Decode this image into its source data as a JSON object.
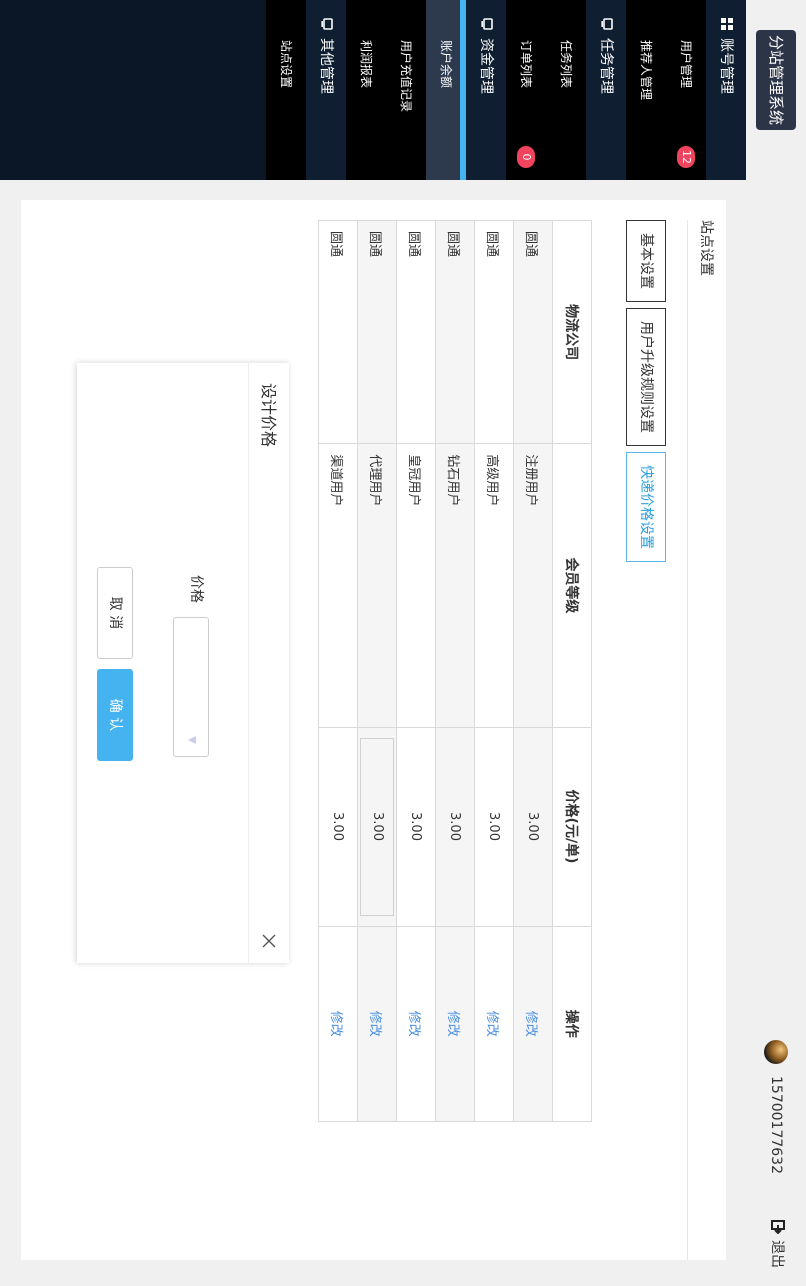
{
  "header": {
    "brand_title": "分站管理系统",
    "user_phone": "15700177632",
    "logout_label": "退出"
  },
  "sidebar": {
    "groups": [
      {
        "label": "账号管理",
        "icon": "grid-icon",
        "items": [
          {
            "label": "用户管理",
            "badge": "12"
          },
          {
            "label": "推荐人管理"
          }
        ]
      },
      {
        "label": "任务管理",
        "icon": "monitor-icon",
        "items": [
          {
            "label": "任务列表"
          },
          {
            "label": "订单列表",
            "badge": "0"
          }
        ]
      },
      {
        "label": "资金管理",
        "icon": "monitor-icon",
        "items": [
          {
            "label": "账户余额",
            "active": true
          },
          {
            "label": "用户充值记录"
          },
          {
            "label": "利润报表"
          }
        ]
      },
      {
        "label": "其他管理",
        "icon": "monitor-icon",
        "items": [
          {
            "label": "站点设置"
          }
        ]
      }
    ]
  },
  "main": {
    "section_title": "站点设置",
    "tabs": [
      {
        "label": "基本设置",
        "active": false
      },
      {
        "label": "用户升级规则设置",
        "active": false
      },
      {
        "label": "快递价格设置",
        "active": true
      }
    ],
    "table": {
      "columns": [
        "物流公司",
        "会员等级",
        "价格(元/单)",
        "操作"
      ],
      "rows": [
        [
          "圆通",
          "注册用户",
          "3.00",
          "修改"
        ],
        [
          "圆通",
          "高级用户",
          "3.00",
          "修改"
        ],
        [
          "圆通",
          "钻石用户",
          "3.00",
          "修改"
        ],
        [
          "圆通",
          "皇冠用户",
          "3.00",
          "修改"
        ],
        [
          "圆通",
          "代理用户",
          "3.00",
          "修改"
        ],
        [
          "圆通",
          "渠道用户",
          "3.00",
          "修改"
        ]
      ]
    }
  },
  "modal": {
    "title": "设计价格",
    "price_label": "价格",
    "price_value": "",
    "cancel_label": "取 消",
    "confirm_label": "确 认"
  },
  "colors": {
    "sidebar_bg": "#0b1726",
    "accent": "#45b3f0",
    "link": "#4a90e2",
    "badge": "#f0435d"
  }
}
